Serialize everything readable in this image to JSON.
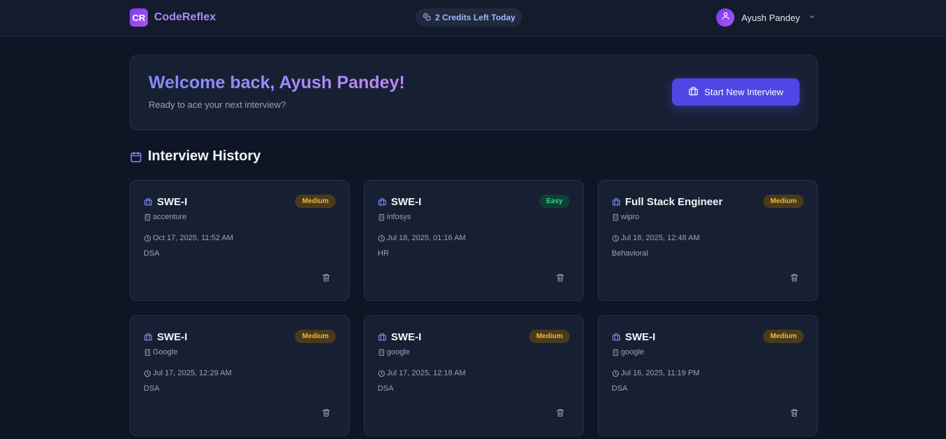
{
  "header": {
    "logo_badge": "CR",
    "logo_text": "CodeReflex",
    "credits": "2 Credits Left Today",
    "user_name": "Ayush Pandey"
  },
  "welcome": {
    "title": "Welcome back, Ayush Pandey!",
    "subtitle": "Ready to ace your next interview?",
    "button": "Start New Interview"
  },
  "history": {
    "title": "Interview History",
    "cards": [
      {
        "role": "SWE-I",
        "difficulty": "Medium",
        "company": "accenture",
        "date": "Oct 17, 2025, 11:52 AM",
        "type": "DSA"
      },
      {
        "role": "SWE-I",
        "difficulty": "Easy",
        "company": "infosys",
        "date": "Jul 18, 2025, 01:16 AM",
        "type": "HR"
      },
      {
        "role": "Full Stack Engineer",
        "difficulty": "Medium",
        "company": "wipro",
        "date": "Jul 18, 2025, 12:48 AM",
        "type": "Behavioral"
      },
      {
        "role": "SWE-I",
        "difficulty": "Medium",
        "company": "Google",
        "date": "Jul 17, 2025, 12:29 AM",
        "type": "DSA"
      },
      {
        "role": "SWE-I",
        "difficulty": "Medium",
        "company": "google",
        "date": "Jul 17, 2025, 12:18 AM",
        "type": "DSA"
      },
      {
        "role": "SWE-I",
        "difficulty": "Medium",
        "company": "google",
        "date": "Jul 16, 2025, 11:19 PM",
        "type": "DSA"
      }
    ]
  },
  "colors": {
    "accent": "#4f46e5",
    "medium_badge": "#f5b82e",
    "easy_badge": "#34d399",
    "background": "#0e1525"
  },
  "icons": {
    "logo": "cr-logo-badge",
    "credits": "coins-icon",
    "avatar": "user-icon",
    "dropdown": "chevron-down-icon",
    "start": "briefcase-icon",
    "history": "calendar-icon",
    "role": "briefcase-icon",
    "company": "building-icon",
    "date": "clock-icon",
    "delete": "trash-icon"
  }
}
